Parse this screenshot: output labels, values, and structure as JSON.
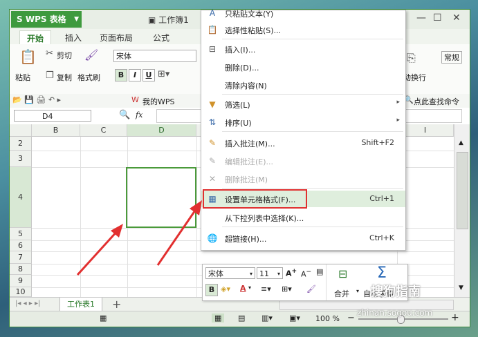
{
  "app": {
    "name": "WPS 表格",
    "doc_title": "工作簿1"
  },
  "tabs": [
    "开始",
    "插入",
    "页面布局",
    "公式"
  ],
  "ribbon": {
    "paste": "粘贴",
    "cut": "剪切",
    "copy": "复制",
    "format_painter": "格式刷",
    "font_name": "宋体",
    "bold": "B",
    "italic": "I",
    "underline": "U",
    "wrap_text": "自动换行",
    "regular": "常规"
  },
  "quickbar": {
    "my_wps": "我的WPS",
    "find": "点此查找命令"
  },
  "formula_bar": {
    "cell_ref": "D4",
    "fx": "fx"
  },
  "columns": [
    "B",
    "C",
    "D",
    "I"
  ],
  "rows": [
    "2",
    "3",
    "4",
    "5",
    "6",
    "7",
    "8",
    "9",
    "10"
  ],
  "context_menu": {
    "items": [
      {
        "label": "只粘贴文本(Y)",
        "icon": "paste-text-icon"
      },
      {
        "label": "选择性粘贴(S)...",
        "icon": "paste-special-icon"
      },
      {
        "label": "插入(I)...",
        "icon": "insert-icon"
      },
      {
        "label": "删除(D)...",
        "icon": ""
      },
      {
        "label": "清除内容(N)",
        "icon": ""
      },
      {
        "label": "筛选(L)",
        "icon": "filter-icon"
      },
      {
        "label": "排序(U)",
        "icon": "sort-icon"
      },
      {
        "label": "插入批注(M)...",
        "shortcut": "Shift+F2",
        "icon": "comment-icon"
      },
      {
        "label": "编辑批注(E)...",
        "icon": "edit-comment-icon"
      },
      {
        "label": "删除批注(M)",
        "icon": "delete-comment-icon"
      },
      {
        "label": "设置单元格格式(F)...",
        "shortcut": "Ctrl+1",
        "icon": "format-cells-icon"
      },
      {
        "label": "从下拉列表中选择(K)...",
        "icon": ""
      },
      {
        "label": "超链接(H)...",
        "shortcut": "Ctrl+K",
        "icon": "hyperlink-icon"
      }
    ]
  },
  "mini_toolbar": {
    "font_name": "宋体",
    "font_size": "11",
    "bold": "B",
    "font_color": "A",
    "merge": "合并",
    "autosum": "自动求和"
  },
  "sheet_tab": "工作表1",
  "status": {
    "zoom": "100 %"
  },
  "watermark": {
    "text": "搜狗指南",
    "url": "zhinan.sogou.com"
  }
}
